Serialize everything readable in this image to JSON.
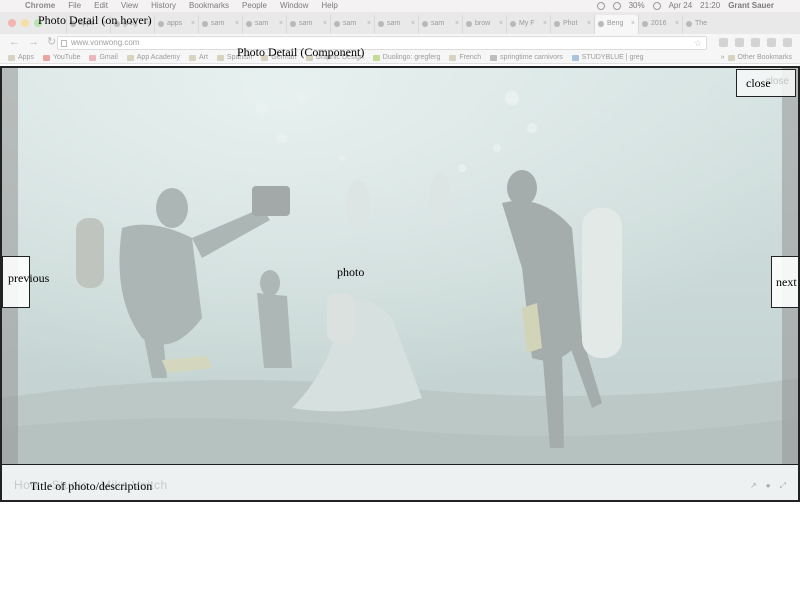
{
  "menubar": {
    "app_name": "Chrome",
    "menus": [
      "File",
      "Edit",
      "View",
      "History",
      "Bookmarks",
      "People",
      "Window",
      "Help"
    ],
    "battery": "30%",
    "date": "Apr 24",
    "time": "21:20",
    "user": "Grant Sauer"
  },
  "tabs": [
    "apps",
    "greg",
    "apps",
    "sam",
    "sam",
    "sam",
    "sam",
    "sam",
    "sam",
    "brow",
    "My F",
    "Phot",
    "Beng",
    "2016",
    "The"
  ],
  "address_bar": {
    "url": "www.vonwong.com"
  },
  "bookmarks": {
    "items": [
      "Apps",
      "YouTube",
      "Gmail",
      "App Academy",
      "Art",
      "Spanish",
      "German",
      "Graphic Design",
      "Duolingo: gregferg",
      "French",
      "springtime carnivors",
      "STUDYBLUE | greg"
    ],
    "other": "Other Bookmarks"
  },
  "annotations": {
    "hover_label": "Photo Detail (on hover)",
    "component_label": "Photo Detail (Component)",
    "photo_label": "photo",
    "previous_label": "previous",
    "next_label": "next",
    "close_label": "close",
    "caption_label": "Title of photo/description"
  },
  "overlay": {
    "close_ghost": "close",
    "caption_ghost": "How · Studio · Mike Veitch"
  },
  "colors": {
    "water": "#9fb8b6",
    "wash": "#ecf4f3",
    "outline": "#222222"
  }
}
